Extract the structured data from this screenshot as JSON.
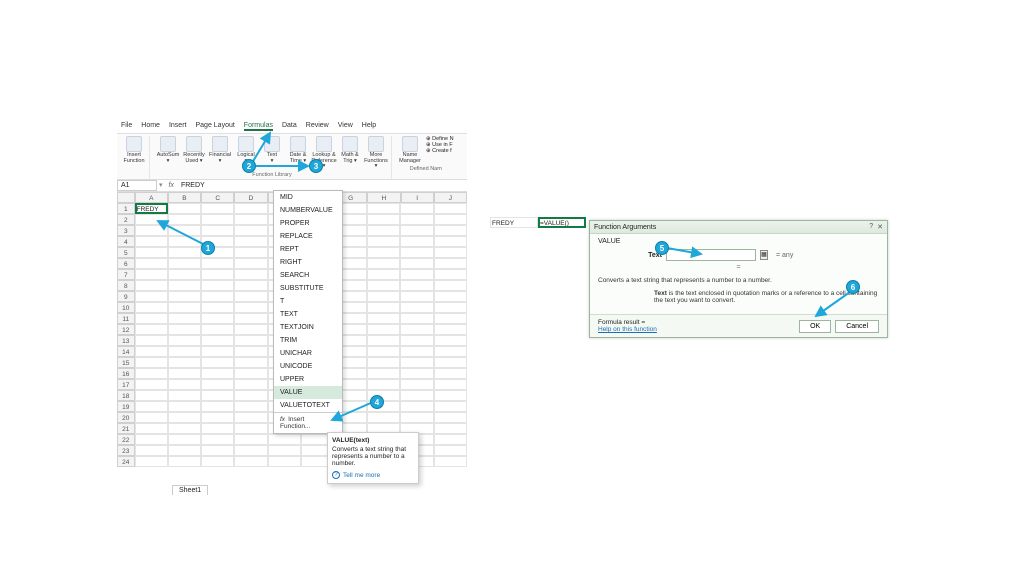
{
  "menubar": [
    "File",
    "Home",
    "Insert",
    "Page Layout",
    "Formulas",
    "Data",
    "Review",
    "View",
    "Help"
  ],
  "menubar_active": "Formulas",
  "ribbon": {
    "group1_label": "",
    "items1": [
      {
        "label": "Insert\nFunction"
      }
    ],
    "items2": [
      {
        "label": "AutoSum\n▾"
      },
      {
        "label": "Recently\nUsed ▾"
      },
      {
        "label": "Financial\n▾"
      },
      {
        "label": "Logical\n▾"
      },
      {
        "label": "Text\n▾"
      },
      {
        "label": "Date &\nTime ▾"
      },
      {
        "label": "Lookup &\nReference ▾"
      },
      {
        "label": "Math &\nTrig ▾"
      },
      {
        "label": "More\nFunctions ▾"
      }
    ],
    "group2_label": "Function Library",
    "items3": [
      {
        "label": "Name\nManager"
      }
    ],
    "side_labels": [
      "Define N",
      "Use in F",
      "Create f"
    ],
    "group3_label": "Defined Nam"
  },
  "ref": {
    "namebox": "A1",
    "formula": "FREDY"
  },
  "columns": [
    "A",
    "B",
    "C",
    "D",
    "E",
    "F",
    "G",
    "H",
    "I",
    "J"
  ],
  "rows": 24,
  "cell_a1": "FREDY",
  "dropdown": {
    "items": [
      "MID",
      "NUMBERVALUE",
      "PROPER",
      "REPLACE",
      "REPT",
      "RIGHT",
      "SEARCH",
      "SUBSTITUTE",
      "T",
      "TEXT",
      "TEXTJOIN",
      "TRIM",
      "UNICHAR",
      "UNICODE",
      "UPPER",
      "VALUE",
      "VALUETOTEXT"
    ],
    "selected": "VALUE",
    "insert_label": "Insert Function..."
  },
  "tooltip": {
    "title": "VALUE(text)",
    "desc": "Converts a text string that represents a number to a number.",
    "more": "Tell me more"
  },
  "sheet_tab": "Sheet1",
  "mini": {
    "a1": "FREDY",
    "b1": "=VALUE()"
  },
  "dialog": {
    "title": "Function Arguments",
    "fn": "VALUE",
    "arg_label": "Text",
    "arg_value": "",
    "eq_text": "= any",
    "result_placeholder": "=",
    "desc": "Converts a text string that represents a number to a number.",
    "arg_desc_label": "Text",
    "arg_desc": "is the text enclosed in quotation marks or a reference to a cell containing the text you want to convert.",
    "formula_result": "Formula result =",
    "help": "Help on this function",
    "ok": "OK",
    "cancel": "Cancel"
  },
  "callouts": {
    "1": "1",
    "2": "2",
    "3": "3",
    "4": "4",
    "5": "5",
    "6": "6"
  }
}
